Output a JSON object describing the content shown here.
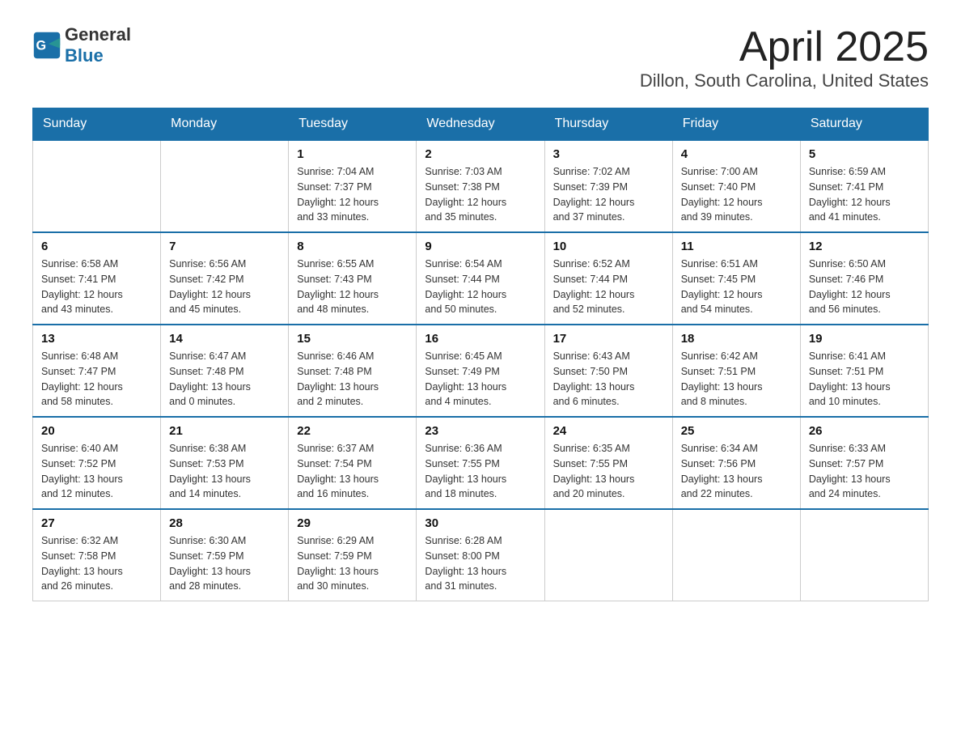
{
  "logo": {
    "text_general": "General",
    "text_blue": "Blue"
  },
  "title": "April 2025",
  "subtitle": "Dillon, South Carolina, United States",
  "days_of_week": [
    "Sunday",
    "Monday",
    "Tuesday",
    "Wednesday",
    "Thursday",
    "Friday",
    "Saturday"
  ],
  "weeks": [
    [
      {
        "day": "",
        "info": ""
      },
      {
        "day": "",
        "info": ""
      },
      {
        "day": "1",
        "info": "Sunrise: 7:04 AM\nSunset: 7:37 PM\nDaylight: 12 hours\nand 33 minutes."
      },
      {
        "day": "2",
        "info": "Sunrise: 7:03 AM\nSunset: 7:38 PM\nDaylight: 12 hours\nand 35 minutes."
      },
      {
        "day": "3",
        "info": "Sunrise: 7:02 AM\nSunset: 7:39 PM\nDaylight: 12 hours\nand 37 minutes."
      },
      {
        "day": "4",
        "info": "Sunrise: 7:00 AM\nSunset: 7:40 PM\nDaylight: 12 hours\nand 39 minutes."
      },
      {
        "day": "5",
        "info": "Sunrise: 6:59 AM\nSunset: 7:41 PM\nDaylight: 12 hours\nand 41 minutes."
      }
    ],
    [
      {
        "day": "6",
        "info": "Sunrise: 6:58 AM\nSunset: 7:41 PM\nDaylight: 12 hours\nand 43 minutes."
      },
      {
        "day": "7",
        "info": "Sunrise: 6:56 AM\nSunset: 7:42 PM\nDaylight: 12 hours\nand 45 minutes."
      },
      {
        "day": "8",
        "info": "Sunrise: 6:55 AM\nSunset: 7:43 PM\nDaylight: 12 hours\nand 48 minutes."
      },
      {
        "day": "9",
        "info": "Sunrise: 6:54 AM\nSunset: 7:44 PM\nDaylight: 12 hours\nand 50 minutes."
      },
      {
        "day": "10",
        "info": "Sunrise: 6:52 AM\nSunset: 7:44 PM\nDaylight: 12 hours\nand 52 minutes."
      },
      {
        "day": "11",
        "info": "Sunrise: 6:51 AM\nSunset: 7:45 PM\nDaylight: 12 hours\nand 54 minutes."
      },
      {
        "day": "12",
        "info": "Sunrise: 6:50 AM\nSunset: 7:46 PM\nDaylight: 12 hours\nand 56 minutes."
      }
    ],
    [
      {
        "day": "13",
        "info": "Sunrise: 6:48 AM\nSunset: 7:47 PM\nDaylight: 12 hours\nand 58 minutes."
      },
      {
        "day": "14",
        "info": "Sunrise: 6:47 AM\nSunset: 7:48 PM\nDaylight: 13 hours\nand 0 minutes."
      },
      {
        "day": "15",
        "info": "Sunrise: 6:46 AM\nSunset: 7:48 PM\nDaylight: 13 hours\nand 2 minutes."
      },
      {
        "day": "16",
        "info": "Sunrise: 6:45 AM\nSunset: 7:49 PM\nDaylight: 13 hours\nand 4 minutes."
      },
      {
        "day": "17",
        "info": "Sunrise: 6:43 AM\nSunset: 7:50 PM\nDaylight: 13 hours\nand 6 minutes."
      },
      {
        "day": "18",
        "info": "Sunrise: 6:42 AM\nSunset: 7:51 PM\nDaylight: 13 hours\nand 8 minutes."
      },
      {
        "day": "19",
        "info": "Sunrise: 6:41 AM\nSunset: 7:51 PM\nDaylight: 13 hours\nand 10 minutes."
      }
    ],
    [
      {
        "day": "20",
        "info": "Sunrise: 6:40 AM\nSunset: 7:52 PM\nDaylight: 13 hours\nand 12 minutes."
      },
      {
        "day": "21",
        "info": "Sunrise: 6:38 AM\nSunset: 7:53 PM\nDaylight: 13 hours\nand 14 minutes."
      },
      {
        "day": "22",
        "info": "Sunrise: 6:37 AM\nSunset: 7:54 PM\nDaylight: 13 hours\nand 16 minutes."
      },
      {
        "day": "23",
        "info": "Sunrise: 6:36 AM\nSunset: 7:55 PM\nDaylight: 13 hours\nand 18 minutes."
      },
      {
        "day": "24",
        "info": "Sunrise: 6:35 AM\nSunset: 7:55 PM\nDaylight: 13 hours\nand 20 minutes."
      },
      {
        "day": "25",
        "info": "Sunrise: 6:34 AM\nSunset: 7:56 PM\nDaylight: 13 hours\nand 22 minutes."
      },
      {
        "day": "26",
        "info": "Sunrise: 6:33 AM\nSunset: 7:57 PM\nDaylight: 13 hours\nand 24 minutes."
      }
    ],
    [
      {
        "day": "27",
        "info": "Sunrise: 6:32 AM\nSunset: 7:58 PM\nDaylight: 13 hours\nand 26 minutes."
      },
      {
        "day": "28",
        "info": "Sunrise: 6:30 AM\nSunset: 7:59 PM\nDaylight: 13 hours\nand 28 minutes."
      },
      {
        "day": "29",
        "info": "Sunrise: 6:29 AM\nSunset: 7:59 PM\nDaylight: 13 hours\nand 30 minutes."
      },
      {
        "day": "30",
        "info": "Sunrise: 6:28 AM\nSunset: 8:00 PM\nDaylight: 13 hours\nand 31 minutes."
      },
      {
        "day": "",
        "info": ""
      },
      {
        "day": "",
        "info": ""
      },
      {
        "day": "",
        "info": ""
      }
    ]
  ]
}
